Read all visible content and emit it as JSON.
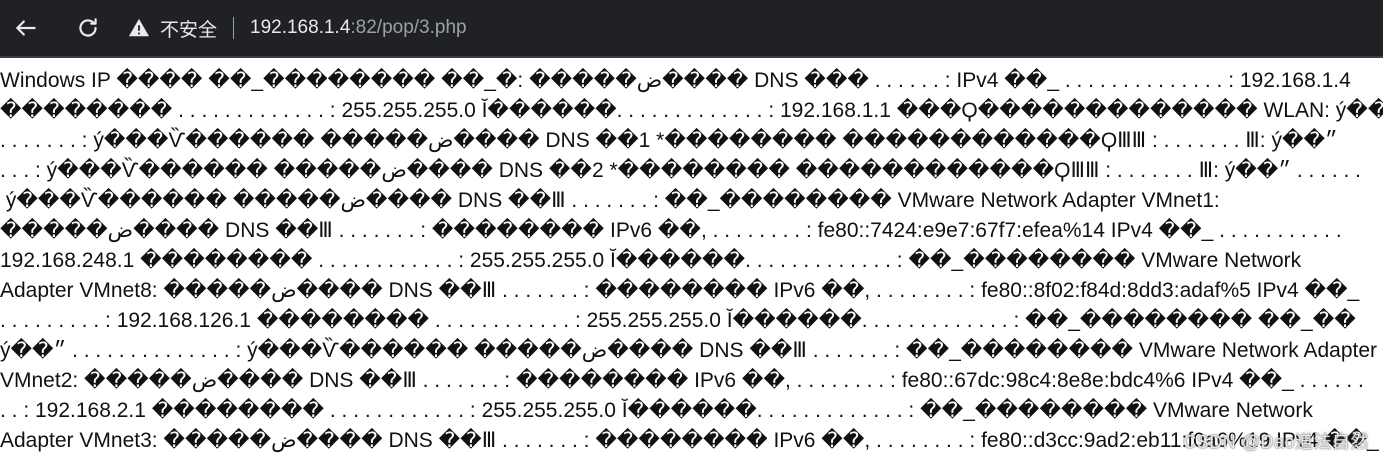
{
  "browser": {
    "back_icon": "arrow-left-icon",
    "reload_icon": "reload-icon",
    "security_icon": "warning-triangle-icon",
    "security_label": "不安全",
    "url_host": "192.168.1.4",
    "url_rest": ":82/pop/3.php"
  },
  "page": {
    "lines": [
      "Windows IP ���� ��_�������� ��_�: �����ض���� DNS ��� . . . . . . : IPv4 ��_ . . . . . . . . . . . . . . : 192.168.1.4",
      "�������� . . . . . . . . . . . . . : 255.255.255.0 Ĭ������. . . . . . . . . . . . . : 192.168.1.1 ���Ϙ������������� WLAN: ý��",
      ". . . . . . . : ý���Ѷ������ �����ض���� DNS ��1 *�������� ������������ϘⅢⅢ : . . . . . . . Ⅲ: ý��״",
      ". . . : ý���Ѷ������ �����ض���� DNS ��2 *�������� ������������ϘⅢⅢ : . . . . . . . Ⅲ: ý��״ . . . . . .",
      " ý���Ѷ������ �����ض���� DNS ��Ⅲ . . . . . . . : ��_�������� VMware Network Adapter VMnet1:",
      "�����ض���� DNS ��Ⅲ . . . . . . . : �������� IPv6 ��, . . . . . . . . : fe80::7424:e9e7:67f7:efea%14 IPv4 ��_ . . . . . . . . . . .",
      "192.168.248.1 �������� . . . . . . . . . . . . : 255.255.255.0 Ĭ������. . . . . . . . . . . . . : ��_�������� VMware Network",
      "Adapter VMnet8: �����ض���� DNS ��Ⅲ . . . . . . . : �������� IPv6 ��, . . . . . . . . : fe80::8f02:f84d:8dd3:adaf%5 IPv4 ��_",
      ". . . . . . . . . : 192.168.126.1 �������� . . . . . . . . . . . . : 255.255.255.0 Ĭ������. . . . . . . . . . . . . : ��_�������� ��_��",
      "ý��״ . . . . . . . . . . . . . . : ý���Ѷ������ �����ض���� DNS ��Ⅲ . . . . . . . : ��_�������� VMware Network Adapter",
      "VMnet2: �����ض���� DNS ��Ⅲ . . . . . . . : �������� IPv6 ��, . . . . . . . . : fe80::67dc:98c4:8e8e:bdc4%6 IPv4 ��_ . . . . . .",
      ". . : 192.168.2.1 �������� . . . . . . . . . . . . : 255.255.255.0 Ĭ������. . . . . . . . . . . . . : ��_�������� VMware Network",
      "Adapter VMnet3: �����ض���� DNS ��Ⅲ . . . . . . . : �������� IPv6 ��, . . . . . . . . : fe80::d3cc:9ad2:eb11:f0a6%19 IPv4 ��_"
    ]
  },
  "watermark": "CSDN @Dao道法自然"
}
